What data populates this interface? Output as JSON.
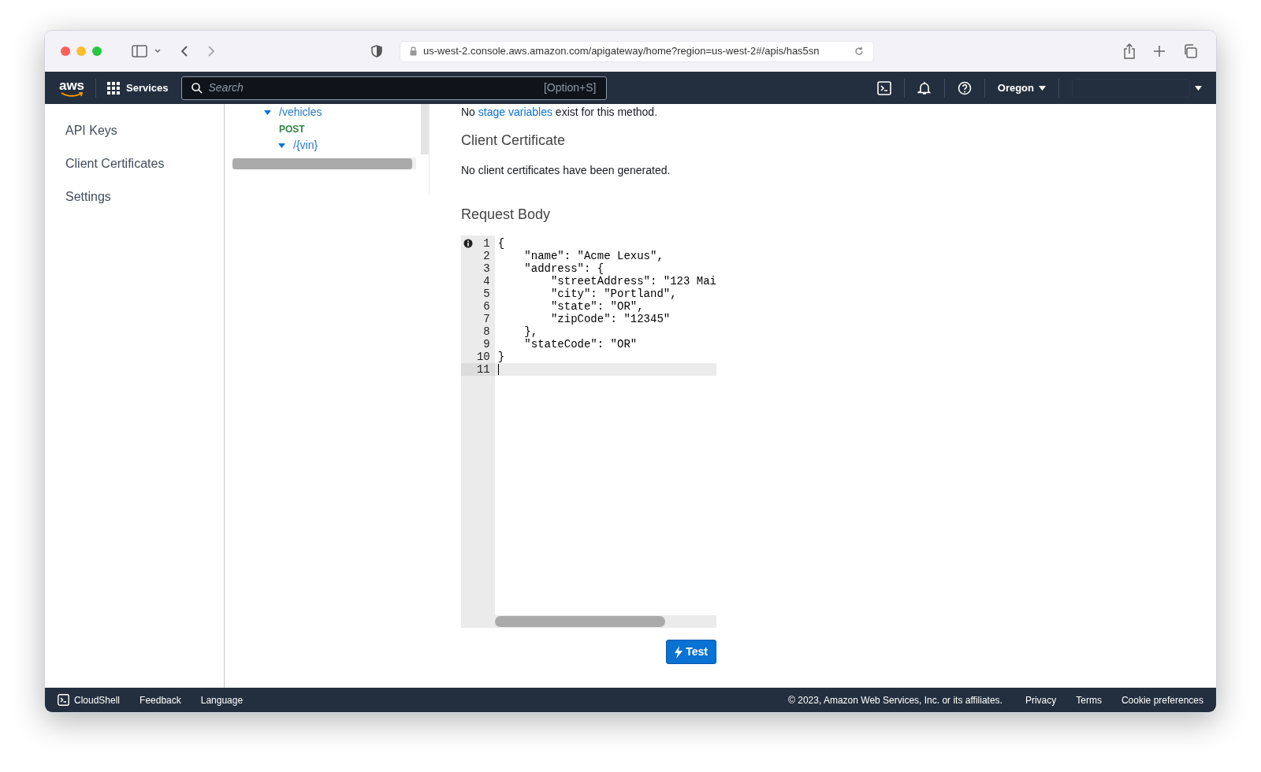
{
  "browser": {
    "url": "us-west-2.console.aws.amazon.com/apigateway/home?region=us-west-2#/apis/has5sn"
  },
  "aws_nav": {
    "logo": "aws",
    "services": "Services",
    "search": {
      "placeholder": "Search",
      "shortcut": "[Option+S]"
    },
    "region": "Oregon"
  },
  "sidebar": {
    "items": [
      {
        "label": "API Keys",
        "selected": false
      },
      {
        "label": "Client Certificates",
        "selected": false
      },
      {
        "label": "Settings",
        "selected": false
      }
    ]
  },
  "resource_tree": [
    {
      "kind": "resource",
      "label": "/vehicles",
      "expanded": true,
      "children": [
        {
          "kind": "method",
          "label": "POST"
        },
        {
          "kind": "resource",
          "label": "/{vin}",
          "expanded": true
        }
      ]
    }
  ],
  "stage_variables_note": {
    "before": "No",
    "link": "stage variables",
    "after": "exist for this method."
  },
  "client_certificate": {
    "heading": "Client Certificate",
    "text": "No client certificates have been generated."
  },
  "request_body": {
    "heading": "Request Body",
    "lines": [
      {
        "number": "1",
        "text": "{",
        "active": false,
        "info": true
      },
      {
        "number": "2",
        "text": "    \"name\": \"Acme Lexus\",",
        "active": false,
        "info": false
      },
      {
        "number": "3",
        "text": "    \"address\": {",
        "active": false,
        "info": false
      },
      {
        "number": "4",
        "text": "        \"streetAddress\": \"123 Mai",
        "active": false,
        "info": false
      },
      {
        "number": "5",
        "text": "        \"city\": \"Portland\",",
        "active": false,
        "info": false
      },
      {
        "number": "6",
        "text": "        \"state\": \"OR\",",
        "active": false,
        "info": false
      },
      {
        "number": "7",
        "text": "        \"zipCode\": \"12345\"",
        "active": false,
        "info": false
      },
      {
        "number": "8",
        "text": "    },",
        "active": false,
        "info": false
      },
      {
        "number": "9",
        "text": "    \"stateCode\": \"OR\"",
        "active": false,
        "info": false
      },
      {
        "number": "10",
        "text": "}",
        "active": false,
        "info": false
      },
      {
        "number": "11",
        "active": true,
        "info": false
      }
    ]
  },
  "test_button": "Test",
  "footer": {
    "cloudshell": "CloudShell",
    "left_links": [
      "Feedback",
      "Language"
    ],
    "copyright": "© 2023, Amazon Web Services, Inc. or its affiliates.",
    "right_links": [
      "Privacy",
      "Terms",
      "Cookie preferences"
    ]
  }
}
